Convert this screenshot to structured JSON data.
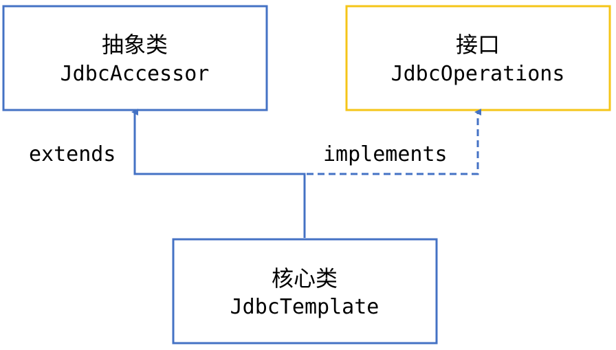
{
  "diagram": {
    "abstract_class": {
      "title": "抽象类",
      "name": "JdbcAccessor"
    },
    "interface": {
      "title": "接口",
      "name": "JdbcOperations"
    },
    "core_class": {
      "title": "核心类",
      "name": "JdbcTemplate"
    },
    "relations": {
      "extends_label": "extends",
      "implements_label": "implements"
    }
  },
  "colors": {
    "class_border": "#4472c4",
    "interface_border": "#f5c518",
    "connector": "#4472c4",
    "text": "#000000"
  }
}
